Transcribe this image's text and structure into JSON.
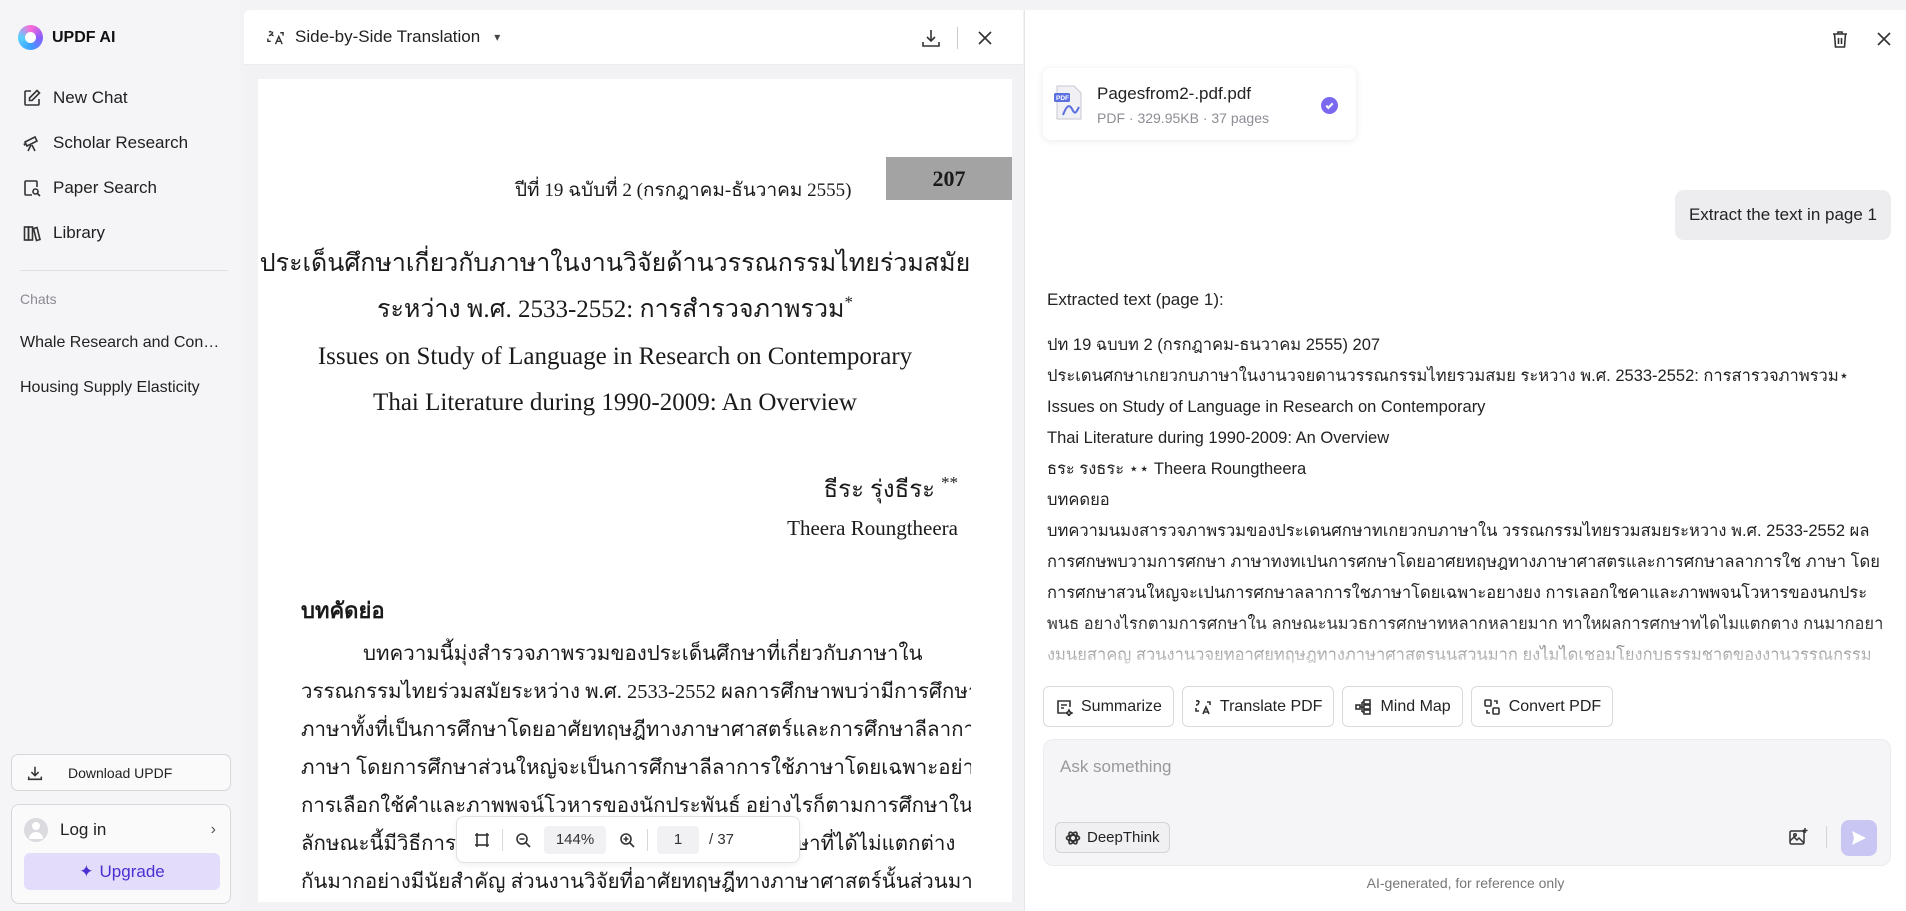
{
  "brand": {
    "name": "UPDF AI"
  },
  "sidebar": {
    "nav": [
      {
        "label": "New Chat",
        "icon": "edit-icon"
      },
      {
        "label": "Scholar Research",
        "icon": "telescope-icon"
      },
      {
        "label": "Paper Search",
        "icon": "doc-search-icon"
      },
      {
        "label": "Library",
        "icon": "library-icon"
      }
    ],
    "chats_label": "Chats",
    "chats": [
      "Whale Research and Conservation",
      "Housing Supply Elasticity"
    ],
    "download_label": "Download UPDF",
    "login_label": "Log in",
    "upgrade_label": "Upgrade"
  },
  "pdf": {
    "title": "Side-by-Side Translation",
    "page": {
      "issue": "ปีที่ 19 ฉบับที่ 2 (กรกฎาคม-ธันวาคม 2555)",
      "page_number": "207",
      "title_th_1": "ประเด็นศึกษาเกี่ยวกับภาษาในงานวิจัยด้านวรรณกรรมไทยร่วมสมัย",
      "title_th_2": "ระหว่าง พ.ศ. 2533-2552: การสำรวจภาพรวม",
      "title_mark": "*",
      "title_en_1": "Issues on Study of Language in Research on Contemporary",
      "title_en_2": "Thai Literature during 1990-2009: An Overview",
      "author_th": "ธีระ รุ่งธีระ",
      "author_mark": "**",
      "author_en": "Theera Roungtheera",
      "abstract_heading": "บทคัดย่อ",
      "abstract_lines": [
        "บทความนี้มุ่งสำรวจภาพรวมของประเด็นศึกษาที่เกี่ยวกับภาษาใน",
        "วรรณกรรมไทยร่วมสมัยระหว่าง พ.ศ. 2533-2552 ผลการศึกษาพบว่ามีการศึกษา",
        "ภาษาทั้งที่เป็นการศึกษาโดยอาศัยทฤษฎีทางภาษาศาสตร์และการศึกษาลีลาการใช้",
        "ภาษา โดยการศึกษาส่วนใหญ่จะเป็นการศึกษาลีลาการใช้ภาษาโดยเฉพาะอย่างยิ่ง",
        "การเลือกใช้คำและภาพพจน์โวหารของนักประพันธ์ อย่างไรก็ตามการศึกษาใน",
        "ลักษณะนี้มีวิธีการศึกษาที่หลากหลายมาก ทำให้ผลการศึกษาที่ได้ไม่แตกต่าง",
        "กันมากอย่างมีนัยสำคัญ ส่วนงานวิจัยที่อาศัยทฤษฎีทางภาษาศาสตร์นั้นส่วนมาก"
      ]
    },
    "toolbar": {
      "zoom": "144%",
      "current_page": "1",
      "total_pages": "/ 37"
    }
  },
  "chat": {
    "file": {
      "name": "Pagesfrom2-.pdf.pdf",
      "meta": "PDF · 329.95KB · 37 pages"
    },
    "user_message": "Extract the text in page 1",
    "response": {
      "heading": "Extracted text (page 1):",
      "lines": [
        "ปท 19 ฉบบท 2 (กรกฎาคม-ธนวาคม 2555) 207",
        "ประเดนศกษาเกยวกบภาษาในงานวจยดานวรรณกรรมไทยรวมสมย ระหวาง พ.ศ. 2533-2552: การสารวจภาพรวม⋆ Issues on Study of Language in Research on Contemporary",
        "Thai Literature during 1990-2009: An Overview",
        "ธระ รงธระ ⋆⋆ Theera Roungtheera",
        "บทคดยอ",
        "บทความนมงสารวจภาพรวมของประเดนศกษาทเกยวกบภาษาใน วรรณกรรมไทยรวมสมยระหวาง พ.ศ. 2533-2552 ผลการศกษพบวามการศกษา ภาษาทงทเปนการศกษาโดยอาศยทฤษฎทางภาษาศาสตรและการศกษาลลาการใช ภาษา โดยการศกษาสวนใหญจะเปนการศกษาลลาการใชภาษาโดยเฉพาะอยางยง การเลอกใชคาและภาพพจนโวหารของนกประพนธ อยางไรกตามการศกษาใน ลกษณะนมวธการศกษาทหลากหลายมาก ทาใหผลการศกษาทไดไมแตกตาง กนมากอยางมนยสาคญ สวนงานวจยทอาศยทฤษฎทางภาษาศาสตรนนสวนมาก ยงไมไดเชอมโยงกบธรรมชาตของงานวรรณกรรมมากนกและมกมองวรรณกรรมใน"
      ]
    },
    "actions": [
      "Summarize",
      "Translate PDF",
      "Mind Map",
      "Convert PDF"
    ],
    "input_placeholder": "Ask something",
    "deepthink_label": "DeepThink",
    "disclaimer": "AI-generated, for reference only"
  },
  "colors": {
    "accent": "#7a68f0",
    "upgrade_bg": "#e3dcfb",
    "upgrade_text": "#4b2fd3",
    "send_btn": "#c9c6f3"
  }
}
